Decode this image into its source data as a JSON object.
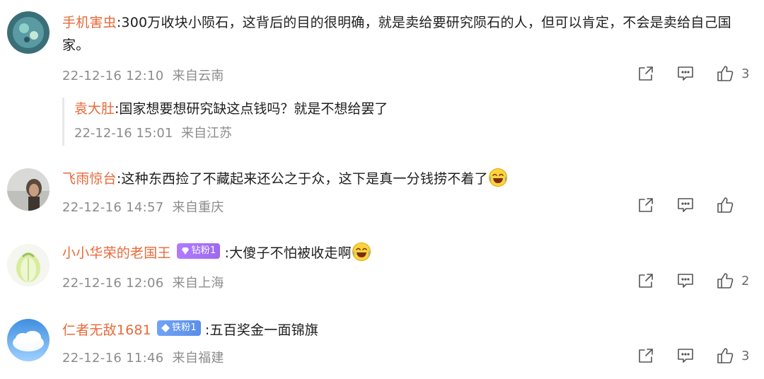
{
  "comments": [
    {
      "username": "手机害虫",
      "text": ":300万收块小陨石，这背后的目的很明确，就是卖给要研究陨石的人，但可以肯定，不会是卖给自己国家。",
      "time": "22-12-16 12:10",
      "location": "来自云南",
      "likes": "3",
      "reply": {
        "username": "袁大肚",
        "text": ":国家想要想研究缺这点钱吗？就是不想给罢了",
        "time": "22-12-16 15:01",
        "location": "来自江苏"
      }
    },
    {
      "username": "飞雨惊台",
      "text": ":这种东西捡了不藏起来还公之于众，这下是真一分钱捞不着了",
      "time": "22-12-16 14:57",
      "location": "来自重庆",
      "likes": ""
    },
    {
      "username": "小小华荣的老国王",
      "badge": "钻粉1",
      "text": ":大傻子不怕被收走啊",
      "time": "22-12-16 12:06",
      "location": "来自上海",
      "likes": "2"
    },
    {
      "username": "仁者无敌1681",
      "badge": "铁粉1",
      "text": ":五百奖金一面锦旗",
      "time": "22-12-16 11:46",
      "location": "来自福建",
      "likes": "3"
    }
  ],
  "colors": {
    "username": "#e86a3a",
    "meta": "#8c8c8c",
    "badge_diamond": "#a974f8",
    "badge_iron": "#6399f0"
  },
  "icons": [
    "share-icon",
    "comment-icon",
    "like-icon",
    "laugh-cry-emoji"
  ]
}
